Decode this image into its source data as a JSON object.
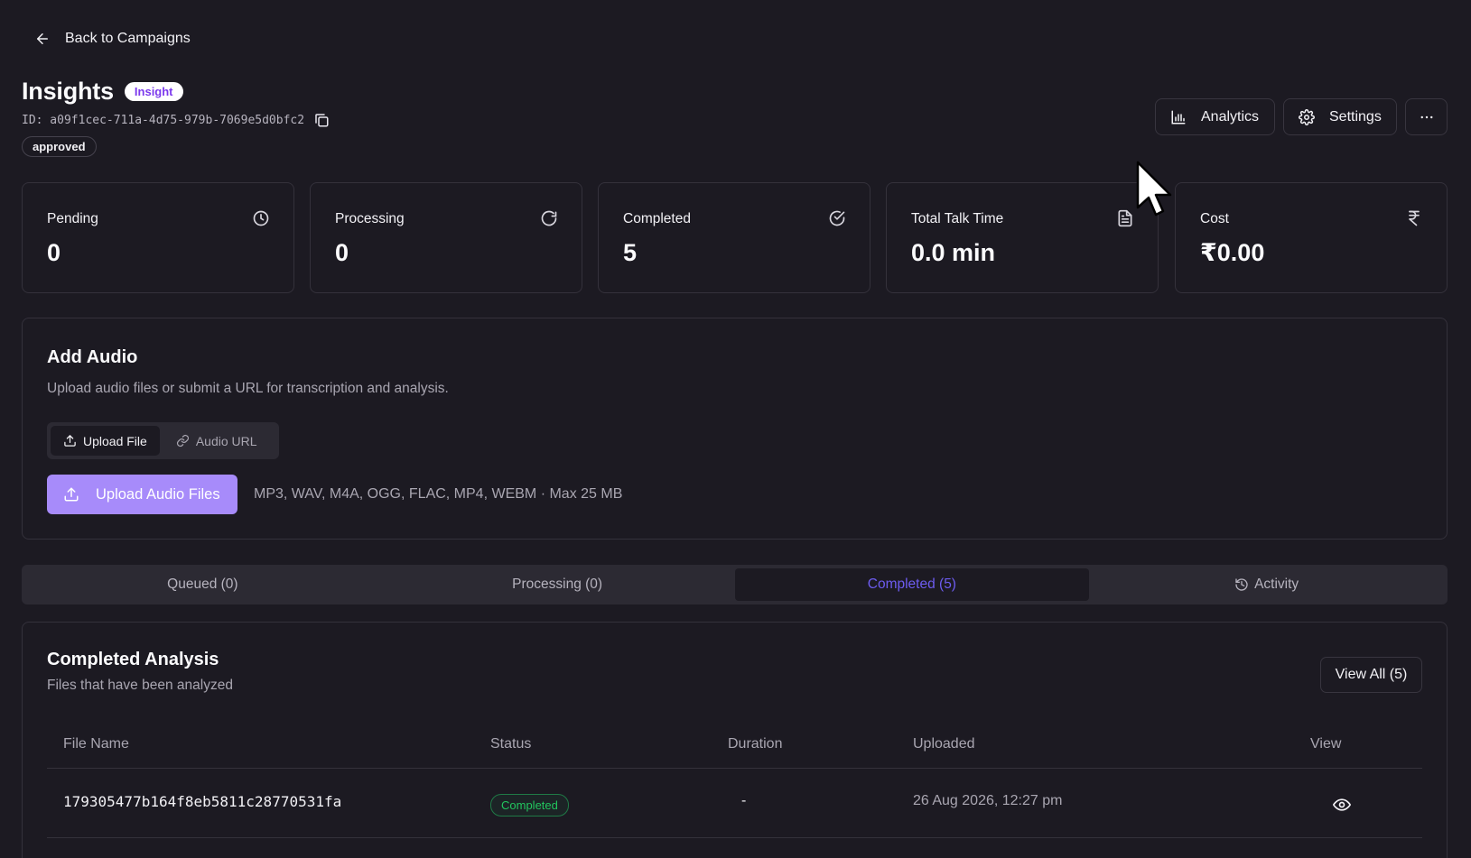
{
  "nav": {
    "back_label": "Back to Campaigns"
  },
  "header": {
    "title": "Insights",
    "badge": "Insight",
    "id_text": "ID: a09f1cec-711a-4d75-979b-7069e5d0bfc2",
    "status": "approved",
    "analytics_label": "Analytics",
    "settings_label": "Settings"
  },
  "stats": [
    {
      "label": "Pending",
      "value": "0",
      "icon": "clock-icon"
    },
    {
      "label": "Processing",
      "value": "0",
      "icon": "refresh-icon"
    },
    {
      "label": "Completed",
      "value": "5",
      "icon": "check-circle-icon"
    },
    {
      "label": "Total Talk Time",
      "value": "0.0 min",
      "icon": "document-icon"
    },
    {
      "label": "Cost",
      "value": "₹0.00",
      "icon": "rupee-icon"
    }
  ],
  "add_audio": {
    "title": "Add Audio",
    "subtitle": "Upload audio files or submit a URL for transcription and analysis.",
    "mode_upload": "Upload File",
    "mode_url": "Audio URL",
    "upload_button": "Upload Audio Files",
    "formats": "MP3, WAV, M4A, OGG, FLAC, MP4, WEBM · Max 25 MB"
  },
  "tabs": [
    {
      "label": "Queued (0)",
      "active": false
    },
    {
      "label": "Processing (0)",
      "active": false
    },
    {
      "label": "Completed (5)",
      "active": true
    },
    {
      "label": "Activity",
      "active": false
    }
  ],
  "completed": {
    "title": "Completed Analysis",
    "subtitle": "Files that have been analyzed",
    "view_all": "View All (5)",
    "columns": [
      "File Name",
      "Status",
      "Duration",
      "Uploaded",
      "View"
    ],
    "rows": [
      {
        "file_name": "179305477b164f8eb5811c28770531fa",
        "status": "Completed",
        "duration": "-",
        "uploaded": "26 Aug 2026, 12:27 pm"
      }
    ]
  },
  "colors": {
    "background": "#1c1a22",
    "accent": "#a78bfa",
    "tab_active": "#6d5cf0",
    "success": "#22c55e"
  }
}
